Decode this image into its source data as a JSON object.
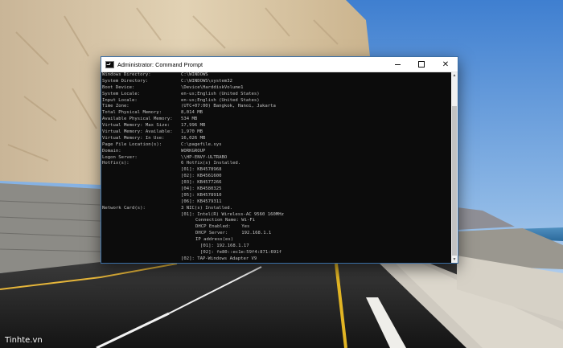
{
  "window": {
    "title": "Administrator: Command Prompt",
    "minimize_icon": "minimize-icon",
    "maximize_icon": "maximize-icon",
    "close_label": "✕"
  },
  "console": {
    "fields": [
      {
        "key": "Windows Directory:",
        "value": "C:\\WINDOWS"
      },
      {
        "key": "System Directory:",
        "value": "C:\\WINDOWS\\system32"
      },
      {
        "key": "Boot Device:",
        "value": "\\Device\\HarddiskVolume1"
      },
      {
        "key": "System Locale:",
        "value": "en-us;English (United States)"
      },
      {
        "key": "Input Locale:",
        "value": "en-us;English (United States)"
      },
      {
        "key": "Time Zone:",
        "value": "(UTC+07:00) Bangkok, Hanoi, Jakarta"
      },
      {
        "key": "Total Physical Memory:",
        "value": "8,014 MB"
      },
      {
        "key": "Available Physical Memory:",
        "value": "534 MB"
      },
      {
        "key": "Virtual Memory: Max Size:",
        "value": "17,996 MB"
      },
      {
        "key": "Virtual Memory: Available:",
        "value": "1,970 MB"
      },
      {
        "key": "Virtual Memory: In Use:",
        "value": "16,026 MB"
      },
      {
        "key": "Page File Location(s):",
        "value": "C:\\pagefile.sys"
      },
      {
        "key": "Domain:",
        "value": "WORKGROUP"
      },
      {
        "key": "Logon Server:",
        "value": "\\\\HP-ENVY-ULTRABO"
      },
      {
        "key": "Hotfix(s):",
        "value": "6 Hotfix(s) Installed."
      }
    ],
    "hotfixes": [
      "[01]: KB4578968",
      "[02]: KB4561600",
      "[03]: KB4577266",
      "[04]: KB4580325",
      "[05]: KB4578910",
      "[06]: KB4579311"
    ],
    "network_label": "Network Card(s):",
    "network_value": "3 NIC(s) Installed.",
    "nic1": "[01]: Intel(R) Wireless-AC 9560 160MHz",
    "nic1_details": [
      "Connection Name: Wi-Fi",
      "DHCP Enabled:    Yes",
      "DHCP Server:     192.168.1.1",
      "IP address(es)"
    ],
    "nic1_ips": [
      "[01]: 192.168.1.17",
      "[02]: fe80::ec1e:59f4:871:691f"
    ],
    "nic2": "[02]: TAP-Windows Adapter V9"
  },
  "watermark": "Tinhte.vn",
  "colors": {
    "console_bg": "#0c0c0c",
    "console_text": "#c0c0c0",
    "titlebar_bg": "#ffffff"
  }
}
